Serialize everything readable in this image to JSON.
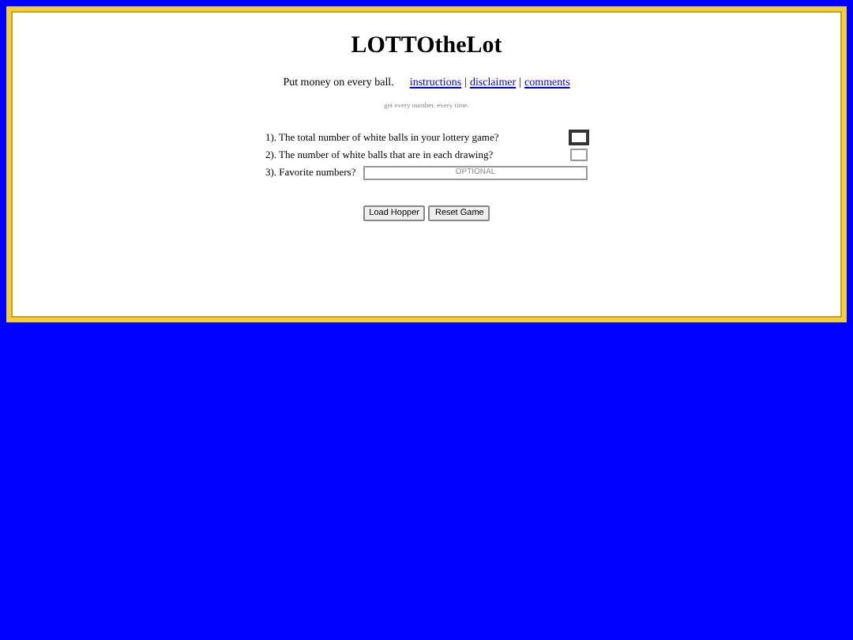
{
  "title": "LOTTOtheLot",
  "tagline": "Put money on every ball.",
  "links": [
    "instructions",
    "disclaimer",
    "comments"
  ],
  "separator": "|",
  "subtitle": "get every number. every time.",
  "questions": [
    {
      "label": "1). The total number of white balls in your lottery game?",
      "kind": "small",
      "focused": true
    },
    {
      "label": "2). The number of white balls that are in each drawing?",
      "kind": "small",
      "focused": false
    },
    {
      "label": "3). Favorite numbers?",
      "kind": "wide",
      "placeholder": "OPTIONAL",
      "focused": false
    }
  ],
  "buttons": [
    "Load Hopper",
    "Reset Game"
  ]
}
